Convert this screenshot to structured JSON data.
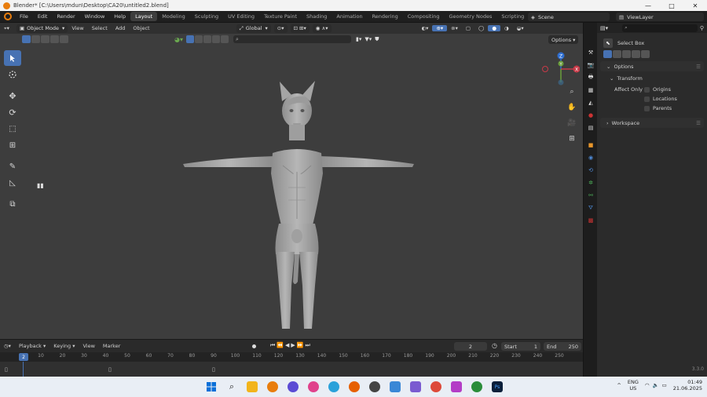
{
  "window": {
    "title": "Blender* [C:\\Users\\mdun\\Desktop\\CA20\\untitled2.blend]",
    "controls": [
      "—",
      "□",
      "✕"
    ]
  },
  "menus": [
    "File",
    "Edit",
    "Render",
    "Window",
    "Help"
  ],
  "workspaces": [
    {
      "label": "Layout",
      "active": true
    },
    {
      "label": "Modeling"
    },
    {
      "label": "Sculpting"
    },
    {
      "label": "UV Editing"
    },
    {
      "label": "Texture Paint"
    },
    {
      "label": "Shading"
    },
    {
      "label": "Animation"
    },
    {
      "label": "Rendering"
    },
    {
      "label": "Compositing"
    },
    {
      "label": "Geometry Nodes"
    },
    {
      "label": "Scripting"
    }
  ],
  "scene": {
    "label": "Scene",
    "view_layer": "ViewLayer"
  },
  "viewport": {
    "mode": "Object Mode",
    "menus": [
      "View",
      "Select",
      "Add",
      "Object"
    ],
    "orientation": "Global",
    "options_label": "Options",
    "tools": [
      "select-box",
      "cursor",
      "move",
      "rotate",
      "scale",
      "transform",
      "annotate",
      "measure",
      "add-cube"
    ],
    "nav": [
      "zoom-icon",
      "hand-icon",
      "camera-icon",
      "grid-icon"
    ],
    "gizmo_axes": {
      "x": "X",
      "y": "Y",
      "z": "Z"
    },
    "accent": "#4772b3"
  },
  "timeline": {
    "menus": [
      "Playback",
      "Keying",
      "View",
      "Marker"
    ],
    "current_frame": "2",
    "start_label": "Start",
    "start_value": "1",
    "end_label": "End",
    "end_value": "250",
    "ruler": [
      "2",
      "10",
      "20",
      "30",
      "40",
      "50",
      "60",
      "70",
      "80",
      "90",
      "100",
      "110",
      "120",
      "130",
      "140",
      "150",
      "160",
      "170",
      "180",
      "190",
      "200",
      "210",
      "220",
      "230",
      "240",
      "250"
    ]
  },
  "properties": {
    "tool_name": "Select Box",
    "options_label": "Options",
    "transform_label": "Transform",
    "affect_only_label": "Affect Only",
    "checkboxes": [
      "Origins",
      "Locations",
      "Parents"
    ],
    "workspace_label": "Workspace",
    "version": "3.3.0"
  },
  "taskbar": {
    "lang": "ENG",
    "region": "US",
    "time": "01:49",
    "date": "21.06.2025"
  }
}
